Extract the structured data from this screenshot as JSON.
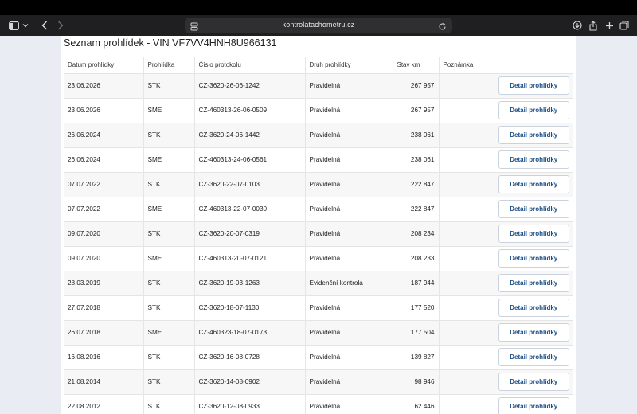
{
  "browser": {
    "url": "kontrolatachometru.cz"
  },
  "page": {
    "title": "Seznam prohlídek - VIN VF7VV4HNH8U966131"
  },
  "table": {
    "headers": [
      "Datum prohlídky",
      "Prohlídka",
      "Číslo protokolu",
      "Druh prohlídky",
      "Stav km",
      "Poznámka",
      ""
    ],
    "rows": [
      {
        "date": "23.06.2026",
        "type": "STK",
        "protocol": "CZ-3620-26-06-1242",
        "kind": "Pravidelná",
        "km": "267 957",
        "note": "",
        "action": "Detail prohlídky"
      },
      {
        "date": "23.06.2026",
        "type": "SME",
        "protocol": "CZ-460313-26-06-0509",
        "kind": "Pravidelná",
        "km": "267 957",
        "note": "",
        "action": "Detail prohlídky"
      },
      {
        "date": "26.06.2024",
        "type": "STK",
        "protocol": "CZ-3620-24-06-1442",
        "kind": "Pravidelná",
        "km": "238 061",
        "note": "",
        "action": "Detail prohlídky"
      },
      {
        "date": "26.06.2024",
        "type": "SME",
        "protocol": "CZ-460313-24-06-0561",
        "kind": "Pravidelná",
        "km": "238 061",
        "note": "",
        "action": "Detail prohlídky"
      },
      {
        "date": "07.07.2022",
        "type": "STK",
        "protocol": "CZ-3620-22-07-0103",
        "kind": "Pravidelná",
        "km": "222 847",
        "note": "",
        "action": "Detail prohlídky"
      },
      {
        "date": "07.07.2022",
        "type": "SME",
        "protocol": "CZ-460313-22-07-0030",
        "kind": "Pravidelná",
        "km": "222 847",
        "note": "",
        "action": "Detail prohlídky"
      },
      {
        "date": "09.07.2020",
        "type": "STK",
        "protocol": "CZ-3620-20-07-0319",
        "kind": "Pravidelná",
        "km": "208 234",
        "note": "",
        "action": "Detail prohlídky"
      },
      {
        "date": "09.07.2020",
        "type": "SME",
        "protocol": "CZ-460313-20-07-0121",
        "kind": "Pravidelná",
        "km": "208 233",
        "note": "",
        "action": "Detail prohlídky"
      },
      {
        "date": "28.03.2019",
        "type": "STK",
        "protocol": "CZ-3620-19-03-1263",
        "kind": "Evidenční kontrola",
        "km": "187 944",
        "note": "",
        "action": "Detail prohlídky"
      },
      {
        "date": "27.07.2018",
        "type": "STK",
        "protocol": "CZ-3620-18-07-1130",
        "kind": "Pravidelná",
        "km": "177 520",
        "note": "",
        "action": "Detail prohlídky"
      },
      {
        "date": "26.07.2018",
        "type": "SME",
        "protocol": "CZ-460323-18-07-0173",
        "kind": "Pravidelná",
        "km": "177 504",
        "note": "",
        "action": "Detail prohlídky"
      },
      {
        "date": "16.08.2016",
        "type": "STK",
        "protocol": "CZ-3620-16-08-0728",
        "kind": "Pravidelná",
        "km": "139 827",
        "note": "",
        "action": "Detail prohlídky"
      },
      {
        "date": "21.08.2014",
        "type": "STK",
        "protocol": "CZ-3620-14-08-0902",
        "kind": "Pravidelná",
        "km": "98 946",
        "note": "",
        "action": "Detail prohlídky"
      },
      {
        "date": "22.08.2012",
        "type": "STK",
        "protocol": "CZ-3620-12-08-0933",
        "kind": "Pravidelná",
        "km": "62 446",
        "note": "",
        "action": "Detail prohlídky"
      }
    ]
  },
  "icons": {
    "sidebar": "sidebar-icon",
    "chevron_down": "chevron-down-icon",
    "back": "back-arrow-icon",
    "forward": "forward-arrow-icon",
    "site": "site-settings-icon",
    "reload": "reload-icon",
    "download": "download-icon",
    "share": "share-icon",
    "new_tab": "plus-icon",
    "tabs": "tab-overview-icon"
  },
  "colors": {
    "link": "#1b4f86",
    "row_alt": "#f7f7f7",
    "toolbar": "#1f1f21"
  }
}
